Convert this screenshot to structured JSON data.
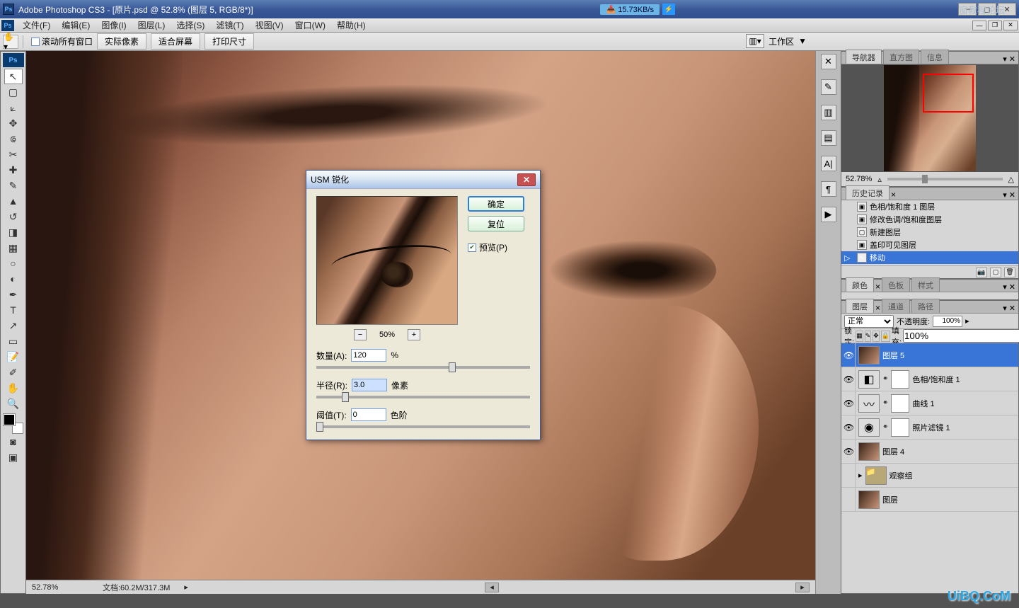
{
  "titlebar": {
    "app": "Adobe Photoshop CS3",
    "doc": "[原片.psd @ 52.8% (图层 5, RGB/8*)]",
    "speed": "15.73KB/s"
  },
  "overlay": "窗教程论坛",
  "menu": {
    "items": [
      "文件(F)",
      "编辑(E)",
      "图像(I)",
      "图层(L)",
      "选择(S)",
      "滤镜(T)",
      "视图(V)",
      "窗口(W)",
      "帮助(H)"
    ]
  },
  "options": {
    "scroll_all": "滚动所有窗口",
    "actual": "实际像素",
    "fit": "适合屏幕",
    "print": "打印尺寸",
    "workspace_label": "工作区"
  },
  "dialog": {
    "title": "USM 锐化",
    "ok": "确定",
    "reset": "复位",
    "preview": "预览(P)",
    "zoom": "50%",
    "amount_label": "数量(A):",
    "amount_value": "120",
    "amount_unit": "%",
    "radius_label": "半径(R):",
    "radius_value": "3.0",
    "radius_unit": "像素",
    "threshold_label": "阈值(T):",
    "threshold_value": "0",
    "threshold_unit": "色阶"
  },
  "navigator": {
    "tabs": [
      "导航器",
      "直方图",
      "信息"
    ],
    "zoom": "52.78%"
  },
  "history": {
    "tab": "历史记录",
    "items": [
      "色相/饱和度 1 图层",
      "修改色调/饱和度图层",
      "新建图层",
      "盖印可见图层",
      "移动"
    ]
  },
  "color": {
    "tabs": [
      "颜色",
      "色板",
      "样式"
    ]
  },
  "layers": {
    "tabs": [
      "图层",
      "通道",
      "路径"
    ],
    "blend": "正常",
    "opacity_label": "不透明度:",
    "opacity": "100%",
    "lock_label": "锁定:",
    "fill_label": "填充:",
    "fill": "100%",
    "rows": [
      {
        "name": "图层 5",
        "type": "img",
        "sel": true
      },
      {
        "name": "色相/饱和度 1",
        "type": "adj",
        "glyph": "◧"
      },
      {
        "name": "曲线 1",
        "type": "adj",
        "glyph": "〰"
      },
      {
        "name": "照片滤镜 1",
        "type": "adj",
        "glyph": "◉"
      },
      {
        "name": "图层 4",
        "type": "img"
      },
      {
        "name": "观察组",
        "type": "folder"
      },
      {
        "name": "图层",
        "type": "img"
      }
    ]
  },
  "status": {
    "zoom": "52.78%",
    "doc": "文档:60.2M/317.3M"
  },
  "watermark": "UiBQ.CoM"
}
